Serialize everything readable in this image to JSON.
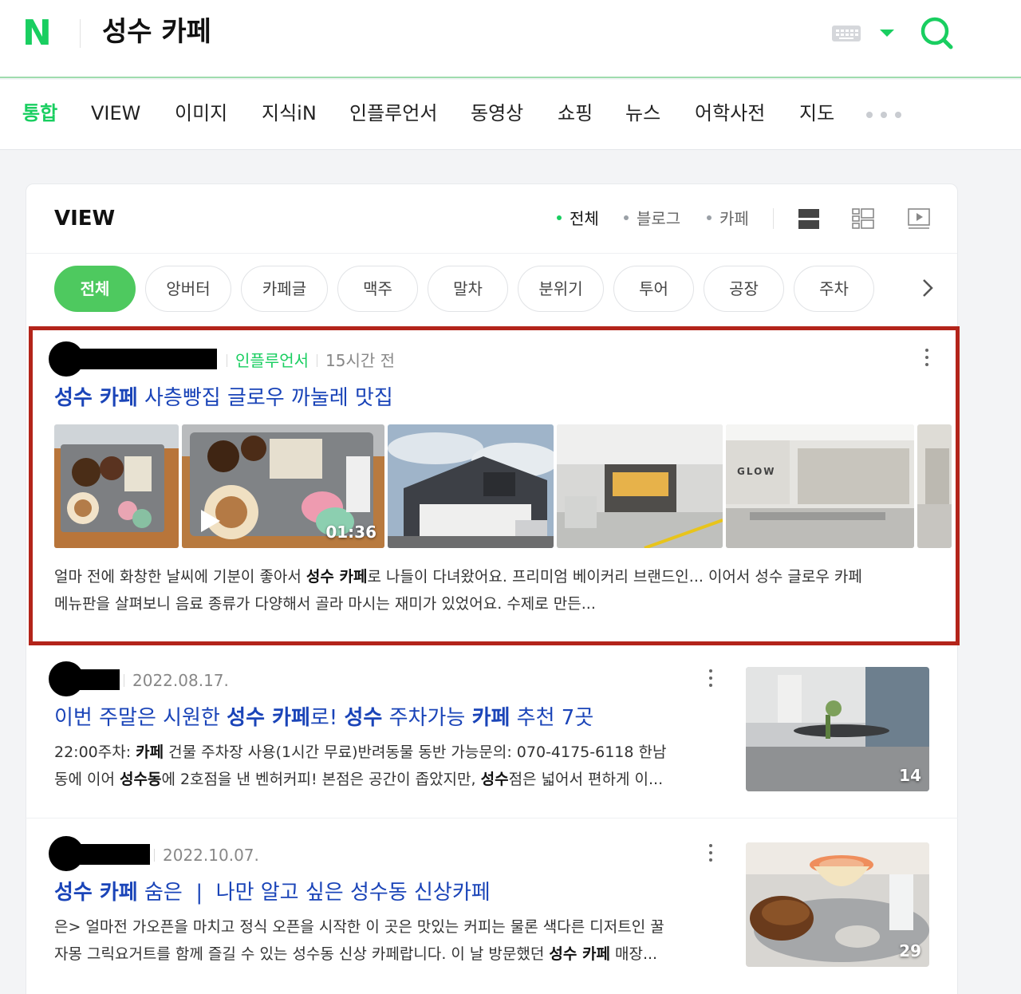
{
  "header": {
    "logo": "N",
    "query": "성수 카페"
  },
  "tabs": [
    "통합",
    "VIEW",
    "이미지",
    "지식iN",
    "인플루언서",
    "동영상",
    "쇼핑",
    "뉴스",
    "어학사전",
    "지도"
  ],
  "view": {
    "title": "VIEW",
    "filters": [
      "전체",
      "블로그",
      "카페"
    ],
    "chips": [
      "전체",
      "앙버터",
      "카페글",
      "맥주",
      "말차",
      "분위기",
      "투어",
      "공장",
      "주차"
    ]
  },
  "results": [
    {
      "source": "인플루언서",
      "time": "15시간 전",
      "title_bold": "성수 카페",
      "title_rest": " 사층빵집 글로우 까눌레 맛집",
      "desc_line1_a": "얼마 전에 화창한 날씨에 기분이 좋아서 ",
      "desc_line1_b": "성수 카페",
      "desc_line1_c": "로 나들이 다녀왔어요. 프리미엄 베이커리 브랜드인... 이어서 성수 글로우 카페",
      "desc_line2": "메뉴판을 살펴보니 음료 종류가 다양해서 골라 마시는 재미가 있었어요. 수제로 만든...",
      "video_duration": "01:36",
      "sign_text": "GLOW"
    },
    {
      "time": "2022.08.17.",
      "title_a": "이번 주말은 시원한 ",
      "title_b": "성수 카페",
      "title_c": "로! ",
      "title_d": "성수",
      "title_e": " 주차가능 ",
      "title_f": "카페",
      "title_g": " 추천 7곳",
      "desc_l1_a": "22:00주차: ",
      "desc_l1_b": "카페",
      "desc_l1_c": " 건물 주차장 사용(1시간 무료)반려동물 동반 가능문의: 070-4175-6118 한남",
      "desc_l2_a": "동에 이어 ",
      "desc_l2_b": "성수동",
      "desc_l2_c": "에 2호점을 낸 벤허커피! 본점은 공간이 좁았지만, ",
      "desc_l2_d": "성수",
      "desc_l2_e": "점은 넓어서 편하게 이...",
      "count": "14"
    },
    {
      "time": "2022.10.07.",
      "title_bold": "성수 카페",
      "title_rest": " 숨은  |  나만 알고 싶은 성수동 신상카페",
      "desc_l1": "은> 얼마전 가오픈을 마치고 정식 오픈을 시작한 이 곳은 맛있는 커피는 물론 색다른 디저트인 꿀",
      "desc_l2_a": "자몽 그릭요거트를 함께 즐길 수 있는 성수동 신상 카페랍니다. 이 날 방문했던 ",
      "desc_l2_b": "성수 카페",
      "desc_l2_c": " 매장...",
      "count": "29"
    }
  ],
  "colors": {
    "brand_green": "#19ce60",
    "chip_green": "#4ec95f",
    "title_blue": "#1a44b8",
    "highlight_red": "#b3241a"
  }
}
